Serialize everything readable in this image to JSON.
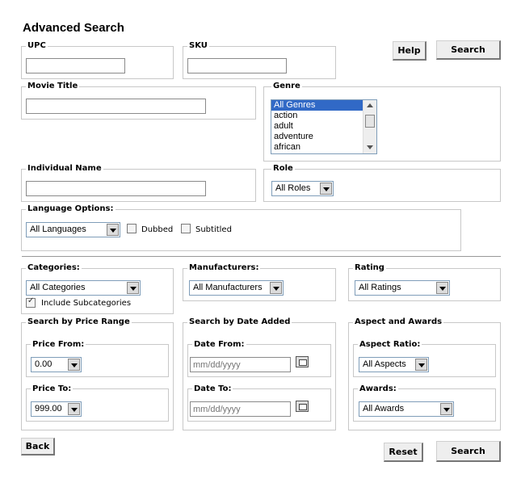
{
  "page_title": "Advanced Search",
  "buttons": {
    "help": "Help",
    "search_top": "Search",
    "back": "Back",
    "reset": "Reset",
    "search_bottom": "Search"
  },
  "upc": {
    "label": "UPC",
    "value": ""
  },
  "sku": {
    "label": "SKU",
    "value": ""
  },
  "movie_title": {
    "label": "Movie Title",
    "value": ""
  },
  "genre": {
    "label": "Genre",
    "options": [
      "All Genres",
      "action",
      "adult",
      "adventure",
      "african"
    ],
    "selected": "All Genres"
  },
  "individual_name": {
    "label": "Individual Name",
    "value": ""
  },
  "role": {
    "label": "Role",
    "selected": "All Roles"
  },
  "language": {
    "label": "Language Options:",
    "selected": "All Languages",
    "dubbed": "Dubbed",
    "subtitled": "Subtitled"
  },
  "categories": {
    "label": "Categories:",
    "selected": "All Categories",
    "include_sub": "Include Subcategories"
  },
  "manufacturers": {
    "label": "Manufacturers:",
    "selected": "All Manufacturers"
  },
  "rating": {
    "label": "Rating",
    "selected": "All Ratings"
  },
  "price": {
    "label": "Search by Price Range",
    "from_label": "Price From:",
    "from_value": "0.00",
    "to_label": "Price To:",
    "to_value": "999.00"
  },
  "date": {
    "label": "Search by Date Added",
    "from_label": "Date From:",
    "from_placeholder": "mm/dd/yyyy",
    "to_label": "Date To:",
    "to_placeholder": "mm/dd/yyyy"
  },
  "aspect": {
    "label": "Aspect and Awards",
    "ratio_label": "Aspect Ratio:",
    "ratio_value": "All Aspects",
    "awards_label": "Awards:",
    "awards_value": "All Awards"
  }
}
